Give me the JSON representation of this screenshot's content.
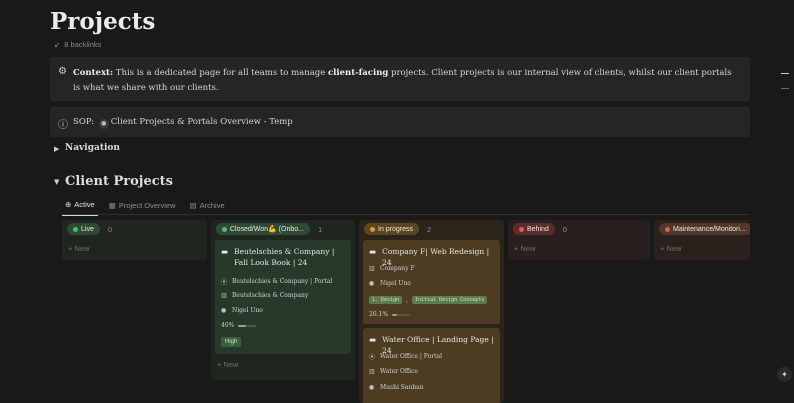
{
  "page": {
    "title": "Projects",
    "backlinks": "8 backlinks",
    "backlinks_icon": "↙"
  },
  "callouts": {
    "context": {
      "icon": "gear-icon",
      "label": "Context:",
      "text1": " This is a dedicated page for all teams to manage ",
      "bold": "client-facing",
      "text2": " projects. Client projects is our internal view of clients, whilst our client portals is what we share with our clients."
    },
    "sop": {
      "icon": "info-icon",
      "label": "SOP:",
      "link": "Client Projects & Portals Overview - Temp"
    }
  },
  "navigation": {
    "label": "Navigation"
  },
  "client_projects": {
    "label": "Client Projects"
  },
  "tabs": [
    {
      "label": "Active",
      "icon": "plus-circle-icon"
    },
    {
      "label": "Project Overview",
      "icon": "board-icon"
    },
    {
      "label": "Archive",
      "icon": "archive-icon"
    }
  ],
  "columns": [
    {
      "label": "Live",
      "count": "0",
      "new": "+ New",
      "color": "#2b8a4a",
      "bg": "#1f2620"
    },
    {
      "label": "Closed/Won💪 (Onbo...",
      "count": "1",
      "new": "+ New",
      "color": "#2b8a4a",
      "bg": "#1f2620"
    },
    {
      "label": "In progress",
      "count": "2",
      "color": "#b68a2c",
      "bg": "#2b2418"
    },
    {
      "label": "Behind",
      "count": "0",
      "new": "+ New",
      "color": "#c0413f",
      "bg": "#2a1f1f"
    },
    {
      "label": "Maintenance/Monitori...",
      "count": "",
      "new": "+ New",
      "color": "#a0573e",
      "bg": "#2a201c"
    }
  ],
  "cards": {
    "beutelschies": {
      "title": "Beutelschies & Company | Fall Look Book | 24",
      "portal": "Beutelschies & Company | Portal",
      "company": "Beutelschies & Company",
      "owner": "Nigel Uno",
      "progress": "40%",
      "progress_value": 0.4,
      "priority": "High"
    },
    "companyf": {
      "title": "Company F| Web Redesign | 24",
      "company": "Company F",
      "owner": "Nigel Uno",
      "tag1": "1. Design",
      "sep": ",",
      "tag2": "Initial Design Concepts",
      "progress": "26.1%",
      "progress_value": 0.261
    },
    "wateroffice": {
      "title": "Water Office | Landing Page | 24",
      "portal": "Water Office | Portal",
      "company": "Water Office",
      "owner": "Mushi Sanban"
    }
  }
}
